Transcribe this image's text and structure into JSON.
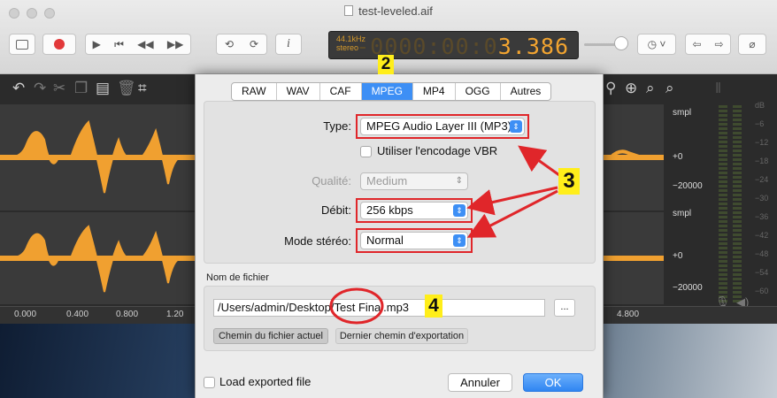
{
  "window": {
    "title": "test-leveled.aif"
  },
  "lcd": {
    "rate": "44.1kHz",
    "channels": "stereo",
    "time_dim": "-0000:00:0",
    "time_lit": "3.386"
  },
  "toolbar": {
    "info_label": "i"
  },
  "timeline": {
    "ticks": [
      "0.000",
      "0.400",
      "0.800",
      "1.20",
      "4.800"
    ]
  },
  "scale": {
    "unit1": "smpl",
    "p1": "+0",
    "m1": "−20000",
    "unit2": "smpl",
    "p2": "+0",
    "m2": "−20000",
    "db": [
      "dB",
      "−6",
      "−12",
      "−18",
      "−24",
      "−30",
      "−36",
      "−42",
      "−48",
      "−54",
      "−60"
    ]
  },
  "dialog": {
    "tabs": [
      "RAW",
      "WAV",
      "CAF",
      "MPEG",
      "MP4",
      "OGG",
      "Autres"
    ],
    "selected_tab": "MPEG",
    "type_label": "Type:",
    "type_value": "MPEG Audio Layer III (MP3)",
    "vbr_label": "Utiliser l'encodage VBR",
    "quality_label": "Qualité:",
    "quality_value": "Medium",
    "bitrate_label": "Débit:",
    "bitrate_value": "256 kbps",
    "stereo_label": "Mode stéréo:",
    "stereo_value": "Normal",
    "filename_heading": "Nom de fichier",
    "filename_value": "/Users/admin/Desktop/Test Final.mp3",
    "browse_label": "...",
    "current_path_button": "Chemin du fichier actuel",
    "last_path_button": "Dernier chemin d'exportation",
    "load_label": "Load exported file",
    "cancel_label": "Annuler",
    "ok_label": "OK"
  },
  "annotations": {
    "two": "2",
    "three": "3",
    "four": "4"
  },
  "colors": {
    "accent": "#3d8ff5",
    "highlight": "#e0262a",
    "badge": "#ffee1a",
    "wave": "#f0a030"
  }
}
